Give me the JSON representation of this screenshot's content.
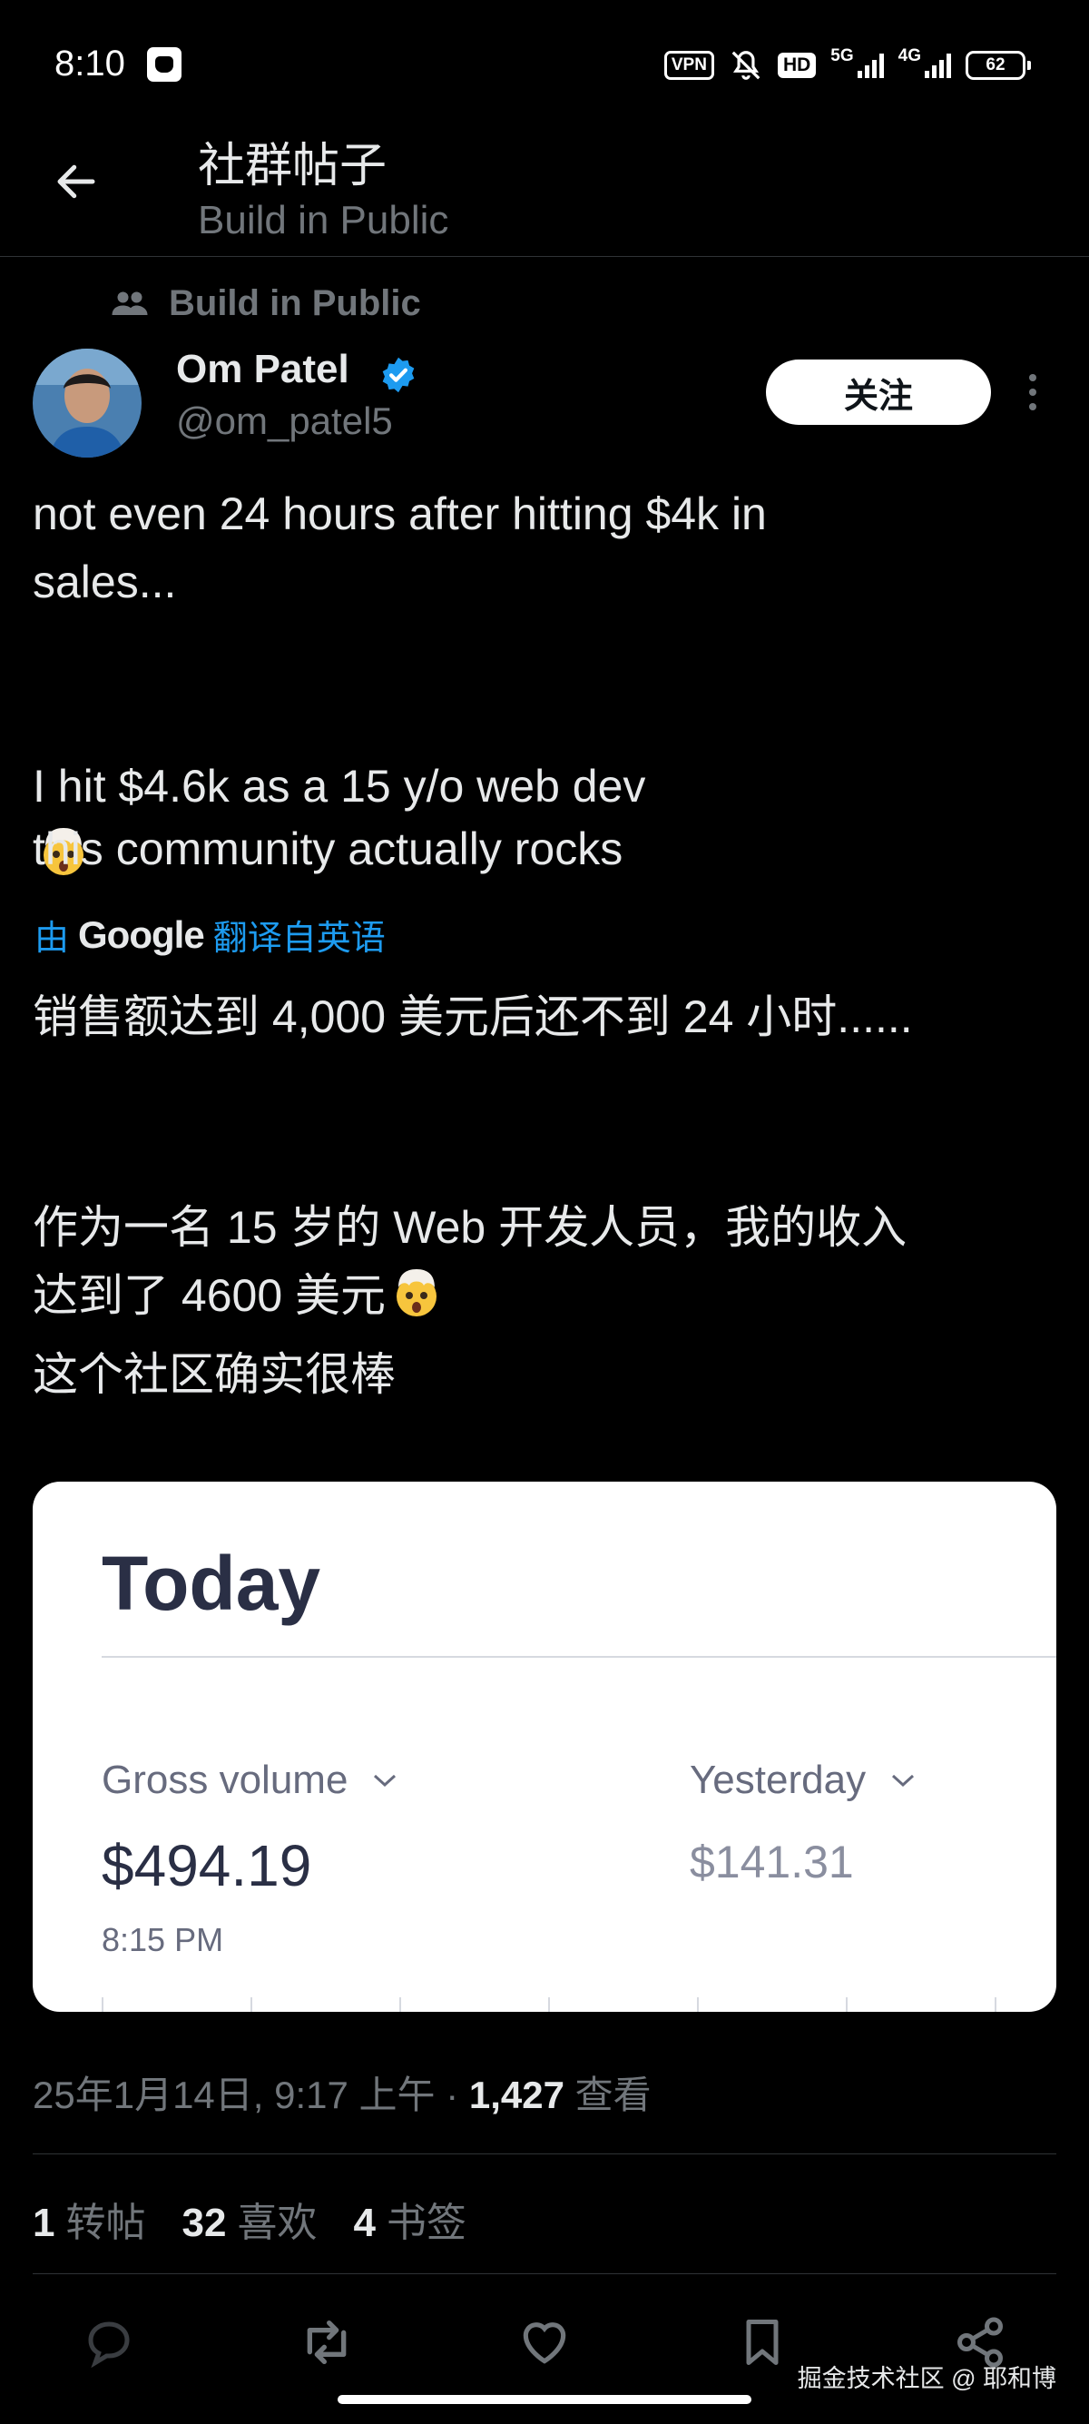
{
  "status_bar": {
    "time": "8:10",
    "vpn": "VPN",
    "hd": "HD",
    "net_5g": "5G",
    "net_4g": "4G",
    "battery": "62"
  },
  "header": {
    "title": "社群帖子",
    "subtitle": "Build in Public"
  },
  "post": {
    "community": "Build in Public",
    "author_name": "Om Patel",
    "author_handle": "@om_patel5",
    "follow_label": "关注",
    "text_en_1": "not even 24 hours after hitting $4k in\nsales...",
    "text_en_2": "I hit $4.6k as a 15 y/o web dev",
    "text_en_3": "this community actually rocks",
    "translate_prefix": "由",
    "translate_brand": "Google",
    "translate_suffix": "翻译自英语",
    "text_zh_1": "销售额达到 4,000 美元后还不到 24 小时......",
    "text_zh_2": "作为一名 15 岁的 Web 开发人员，我的收入\n达到了 4600 美元",
    "text_zh_3": "这个社区确实很棒"
  },
  "image_card": {
    "title": "Today",
    "gross_label": "Gross volume",
    "gross_value": "$494.19",
    "time_note": "8:15 PM",
    "compare_label": "Yesterday",
    "compare_value": "$141.31"
  },
  "meta": {
    "date": "25年1月14日, 9:17 上午 · ",
    "views_count": "1,427",
    "views_label": " 查看"
  },
  "stats": {
    "reposts_count": "1",
    "reposts_label": "转帖",
    "likes_count": "32",
    "likes_label": "喜欢",
    "bookmarks_count": "4",
    "bookmarks_label": "书签"
  },
  "watermark": "掘金技术社区 @ 耶和博",
  "colors": {
    "background": "#000000",
    "text_primary": "#e7e9ea",
    "text_secondary": "#71767b",
    "accent_blue": "#1d9bf0",
    "divider": "#2f3336"
  },
  "icons": [
    "back-arrow-icon",
    "community-icon",
    "verified-badge-icon",
    "mind-blown-emoji",
    "chevron-down-icon",
    "reply-icon",
    "repost-icon",
    "like-icon",
    "bookmark-icon",
    "share-icon"
  ]
}
